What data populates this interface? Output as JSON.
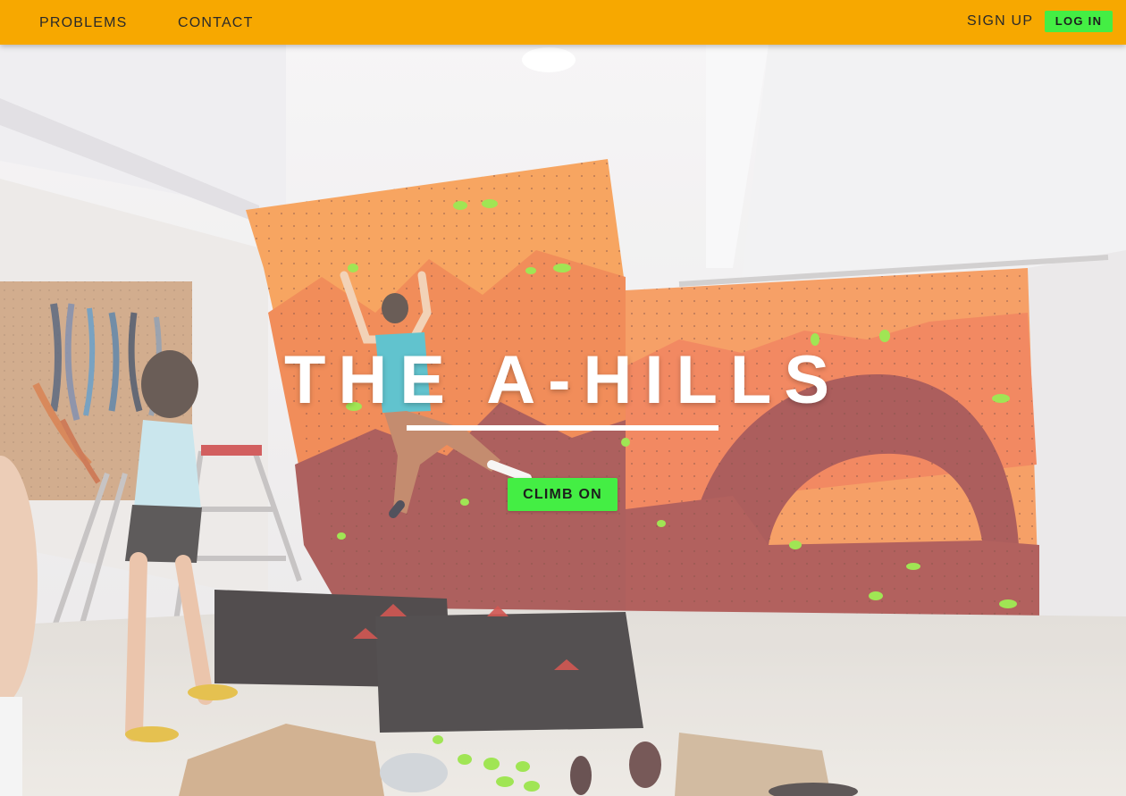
{
  "nav": {
    "left_links": [
      "PROBLEMS",
      "CONTACT"
    ],
    "signup_label": "SIGN UP",
    "login_label": "LOG IN"
  },
  "hero": {
    "title": "THE A-HILLS",
    "cta_label": "CLIMB ON",
    "image_alt": "Climbers on an orange home bouldering wall in a garage"
  },
  "colors": {
    "navbar": "#f7a800",
    "button_green": "#44ee44",
    "wall_orange": "#f58a40",
    "wall_maroon": "#9a3d3a"
  }
}
